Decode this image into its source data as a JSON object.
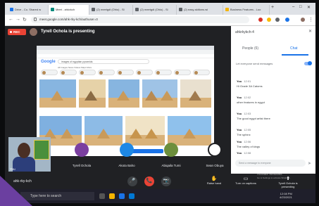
{
  "browser": {
    "tabs": [
      {
        "label": "Drive - Co. Shared w"
      },
      {
        "label": "Meet - ahkvkch"
      },
      {
        "label": "(2) meetgdi (Ohio) - Sl"
      },
      {
        "label": "(2) meetgdi (Ohio) - Sl"
      },
      {
        "label": "(2) easy-skitions.wi"
      },
      {
        "label": "Business Features - Loo"
      }
    ],
    "new_tab": "+",
    "url": "meet.google.com/ahk-rky-kch/authuser=0"
  },
  "meet": {
    "rec_label": "REC",
    "presenter_text": "Tyrell Ochola is presenting",
    "shared_search_text": "images of egyptian pyramids",
    "shared_logo": "Google",
    "shared_nav": "All  Images  News  Videos  Maps  More",
    "self_label": "You",
    "participants": [
      {
        "name": "Tyrell Ochola",
        "color": "#7b3fa0"
      },
      {
        "name": "Akota Baho",
        "color": "#1e88e5"
      },
      {
        "name": "Abiqaila Tumi",
        "color": "#6d8f3c"
      },
      {
        "name": "Sean Obuya",
        "color": "#202124"
      }
    ],
    "meeting_code": "ahk-rky-kch",
    "controls": {
      "mic": "🎤",
      "end": "📞",
      "cam": "📷",
      "raise_hand": "Raise hand",
      "captions": "Turn on captions",
      "present": "Tyrell Ochola is presenting"
    }
  },
  "panel": {
    "title": "ahkrkykch-4",
    "close": "✕",
    "tabs": {
      "people": "People (6)",
      "chat": "Chat"
    },
    "toggle_label": "Let everyone send messages",
    "messages": [
      {
        "sender": "You",
        "time": "12:01",
        "body": "Hi Grade 3A Catoms"
      },
      {
        "sender": "You",
        "time": "12:02",
        "body": "other features in egypt"
      },
      {
        "sender": "You",
        "time": "12:03",
        "body": "The good egypt artist there"
      },
      {
        "sender": "You",
        "time": "12:05",
        "body": "The sphinx"
      },
      {
        "sender": "You",
        "time": "12:06",
        "body": "The valley of kings"
      },
      {
        "sender": "You",
        "time": "12:08",
        "body": ""
      }
    ],
    "input_placeholder": "Send a message to everyone",
    "send": "➤"
  },
  "taskbar": {
    "search_placeholder": "Type here to search",
    "time": "12:08 PM",
    "date": "4/23/2021"
  },
  "watermark": {
    "line1": "Activate Windows",
    "line2": "Go to Settings to activate Windows."
  }
}
